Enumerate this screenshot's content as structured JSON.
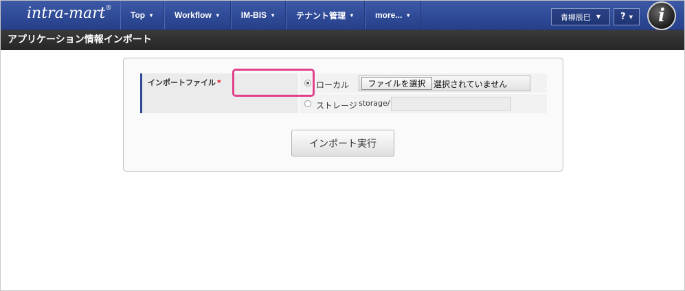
{
  "header": {
    "logo": "intra-mart",
    "logo_mark": "®",
    "menu": [
      {
        "label": "Top"
      },
      {
        "label": "Workflow"
      },
      {
        "label": "IM-BIS"
      },
      {
        "label": "テナント管理"
      },
      {
        "label": "more..."
      }
    ],
    "user_name": "青柳辰巳",
    "help_label": "?",
    "brand_icon": "i"
  },
  "page": {
    "title": "アプリケーション情報インポート"
  },
  "form": {
    "import_file_label": "インポートファイル",
    "required_mark": "*",
    "local_label": "ローカル",
    "file_button_label": "ファイルを選択",
    "file_status": "選択されていません",
    "storage_label": "ストレージ",
    "storage_prefix": "storage/",
    "storage_value": "",
    "local_selected": true
  },
  "actions": {
    "execute_label": "インポート実行"
  },
  "colors": {
    "nav_bg": "#2f4a96",
    "title_bg": "#2b2b2b",
    "highlight": "#e0428a",
    "required": "#d9001b"
  }
}
